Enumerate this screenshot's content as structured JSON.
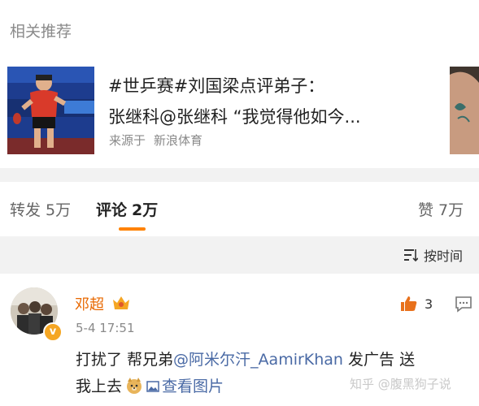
{
  "related": {
    "section_title": "相关推荐",
    "card": {
      "title_line1": "#世乒赛#刘国梁点评弟子：",
      "title_line2": "张继科@张继科 “我觉得他如今...",
      "source_prefix": "来源于",
      "source_name": "新浪体育"
    }
  },
  "tabs": {
    "repost": {
      "label": "转发",
      "count": "5万"
    },
    "comments": {
      "label": "评论",
      "count": "2万"
    },
    "likes": {
      "label": "赞",
      "count": "7万"
    },
    "accent": "#ff8200"
  },
  "sort": {
    "label": "按时间",
    "icon": "sort-icon"
  },
  "comment": {
    "username": "邓超",
    "time": "5-4 17:51",
    "likes": "3",
    "text_part1": "打扰了 帮兄弟",
    "mention": "@阿米尔汗_AamirKhan",
    "text_part2": " 发广告 送",
    "text_line2": "我上去",
    "image_link": "查看图片",
    "username_color": "#e86800",
    "link_color": "#4a6aa5"
  },
  "watermark": "知乎 @腹黑狗子说"
}
